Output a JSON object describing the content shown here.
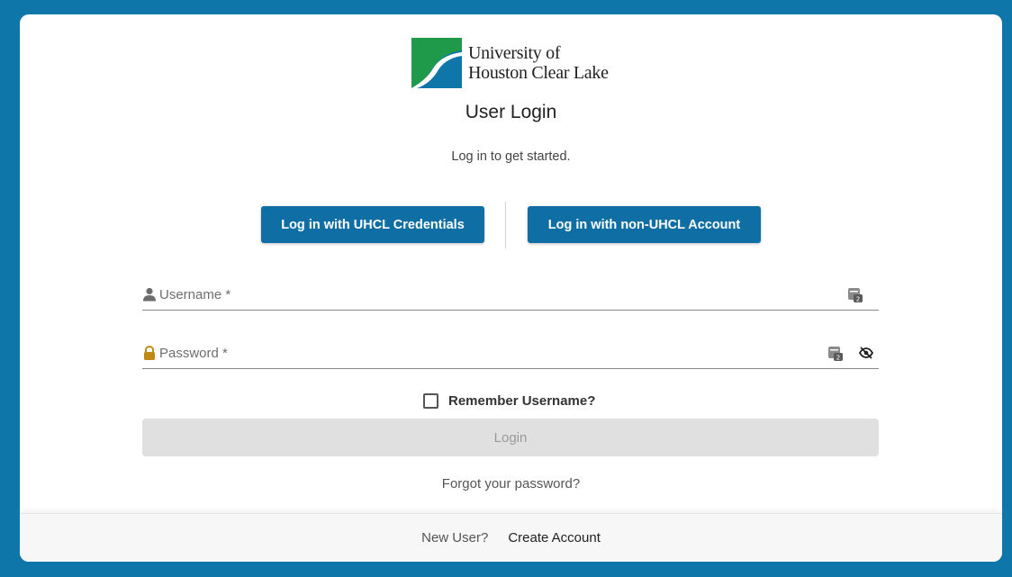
{
  "branding": {
    "university_line1": "University of",
    "university_line2": "Houston Clear Lake",
    "colors": {
      "green": "#1f9a4a",
      "blue": "#0e76a8",
      "page_bg": "#0e76a8"
    }
  },
  "header": {
    "title": "User Login",
    "subtitle": "Log in to get started."
  },
  "sso": {
    "uhcl_label": "Log in with UHCL Credentials",
    "non_uhcl_label": "Log in with non-UHCL Account",
    "button_color": "#0f6ea4"
  },
  "form": {
    "username": {
      "label": "Username *",
      "value": "",
      "icon": "user-icon"
    },
    "password": {
      "label": "Password *",
      "value": "",
      "icon": "lock-icon",
      "lock_color": "#c08a16"
    },
    "remember_label": "Remember Username?",
    "remember_checked": false,
    "login_label": "Login",
    "forgot_label": "Forgot your password?"
  },
  "footer": {
    "new_user_label": "New User?",
    "create_account_label": "Create Account"
  }
}
